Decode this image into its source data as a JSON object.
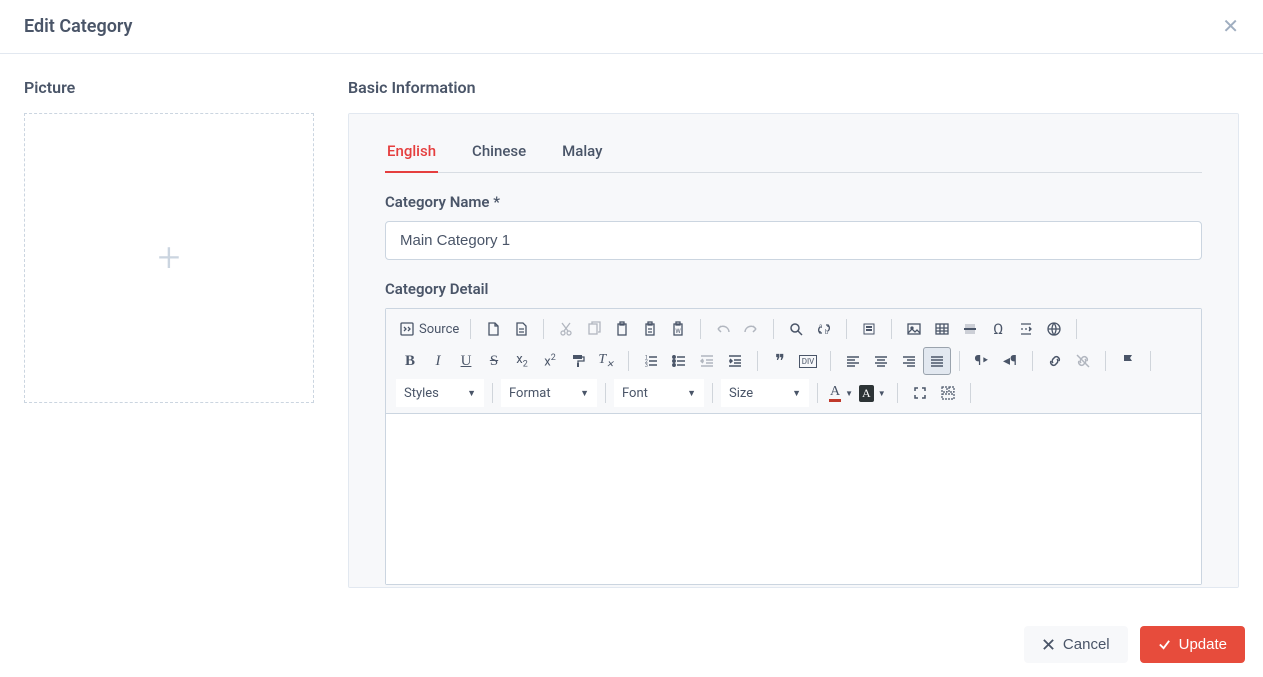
{
  "header": {
    "title": "Edit Category"
  },
  "picture": {
    "section_label": "Picture"
  },
  "basic_info": {
    "section_label": "Basic Information",
    "tabs": [
      {
        "label": "English",
        "active": true
      },
      {
        "label": "Chinese",
        "active": false
      },
      {
        "label": "Malay",
        "active": false
      }
    ],
    "category_name_label": "Category Name *",
    "category_name_value": "Main Category 1",
    "category_detail_label": "Category Detail",
    "editor": {
      "source_label": "Source",
      "dropdowns": {
        "styles": "Styles",
        "format": "Format",
        "font": "Font",
        "size": "Size"
      }
    }
  },
  "footer": {
    "cancel_label": "Cancel",
    "update_label": "Update"
  }
}
